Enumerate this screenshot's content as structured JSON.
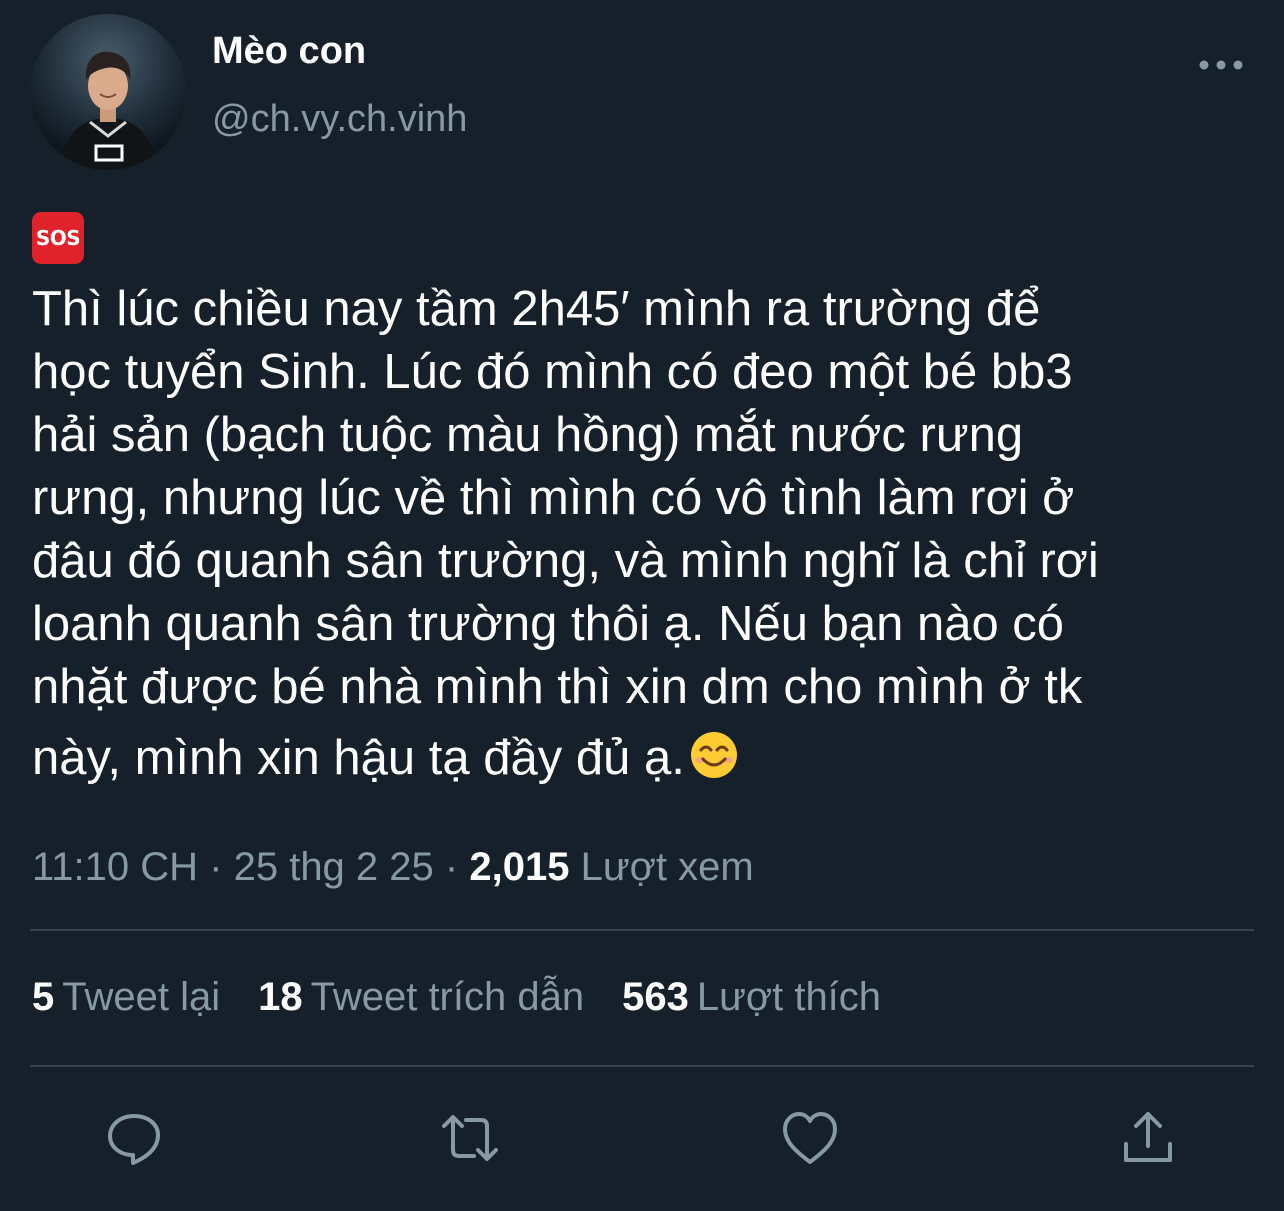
{
  "user": {
    "display_name": "Mèo con",
    "handle": "@ch.vy.ch.vinh"
  },
  "tweet": {
    "badge_text": "SOS",
    "lines": [
      "Thì lúc chiều nay tầm 2h45′ mình ra trường để",
      "học tuyển Sinh. Lúc đó mình có đeo một bé bb3",
      "hải sản (bạch tuộc màu hồng) mắt nước rưng",
      "rưng, nhưng lúc về thì mình có vô tình làm rơi ở",
      "đâu đó quanh sân trường, và mình nghĩ là chỉ rơi",
      "loanh quanh sân trường thôi ạ. Nếu bạn nào có",
      "nhặt được bé nhà mình thì xin dm cho mình ở tk",
      "này, mình xin hậu tạ đầy đủ ạ."
    ],
    "trailing_emoji": "smiling-face"
  },
  "meta": {
    "time": "11:10 CH",
    "date": "25 thg 2 25",
    "separator": "·",
    "views_count": "2,015",
    "views_label": "Lượt xem"
  },
  "stats": {
    "retweets_count": "5",
    "retweets_label": "Tweet lại",
    "quotes_count": "18",
    "quotes_label": "Tweet trích dẫn",
    "likes_count": "563",
    "likes_label": "Lượt thích"
  },
  "actions": [
    "reply-icon",
    "retweet-icon",
    "like-icon",
    "share-icon"
  ],
  "colors": {
    "background": "#15202b",
    "primary_text": "#ffffff",
    "secondary_text": "#8899a6",
    "divider": "#38444d",
    "sos_badge": "#e0232b"
  }
}
